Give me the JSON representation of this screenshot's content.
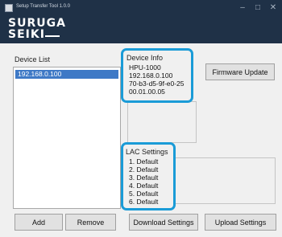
{
  "window": {
    "title": "Setup Transfer Tool 1.0.0",
    "minimize_glyph": "–",
    "maximize_glyph": "□",
    "close_glyph": "✕"
  },
  "logo": {
    "line1": "SURUGA",
    "line2": "SEIKI"
  },
  "device_list": {
    "label": "Device List",
    "items": [
      "192.168.0.100"
    ],
    "add_label": "Add",
    "remove_label": "Remove"
  },
  "device_info": {
    "label": "Device Info",
    "lines": [
      "HPU-1000",
      "192.168.0.100",
      "70-b3-d5-9f-e0-25",
      "00.01.00.05"
    ]
  },
  "firmware_update_label": "Firmware Update",
  "lac_settings": {
    "label": "LAC Settings",
    "lines": [
      "1. Default",
      "2. Default",
      "3. Default",
      "4. Default",
      "5. Default",
      "6. Default"
    ]
  },
  "download_settings_label": "Download Settings",
  "upload_settings_label": "Upload Settings",
  "colors": {
    "title_bar": "#1f3147",
    "highlight": "#1a9bd7",
    "selection": "#3e79c6"
  }
}
